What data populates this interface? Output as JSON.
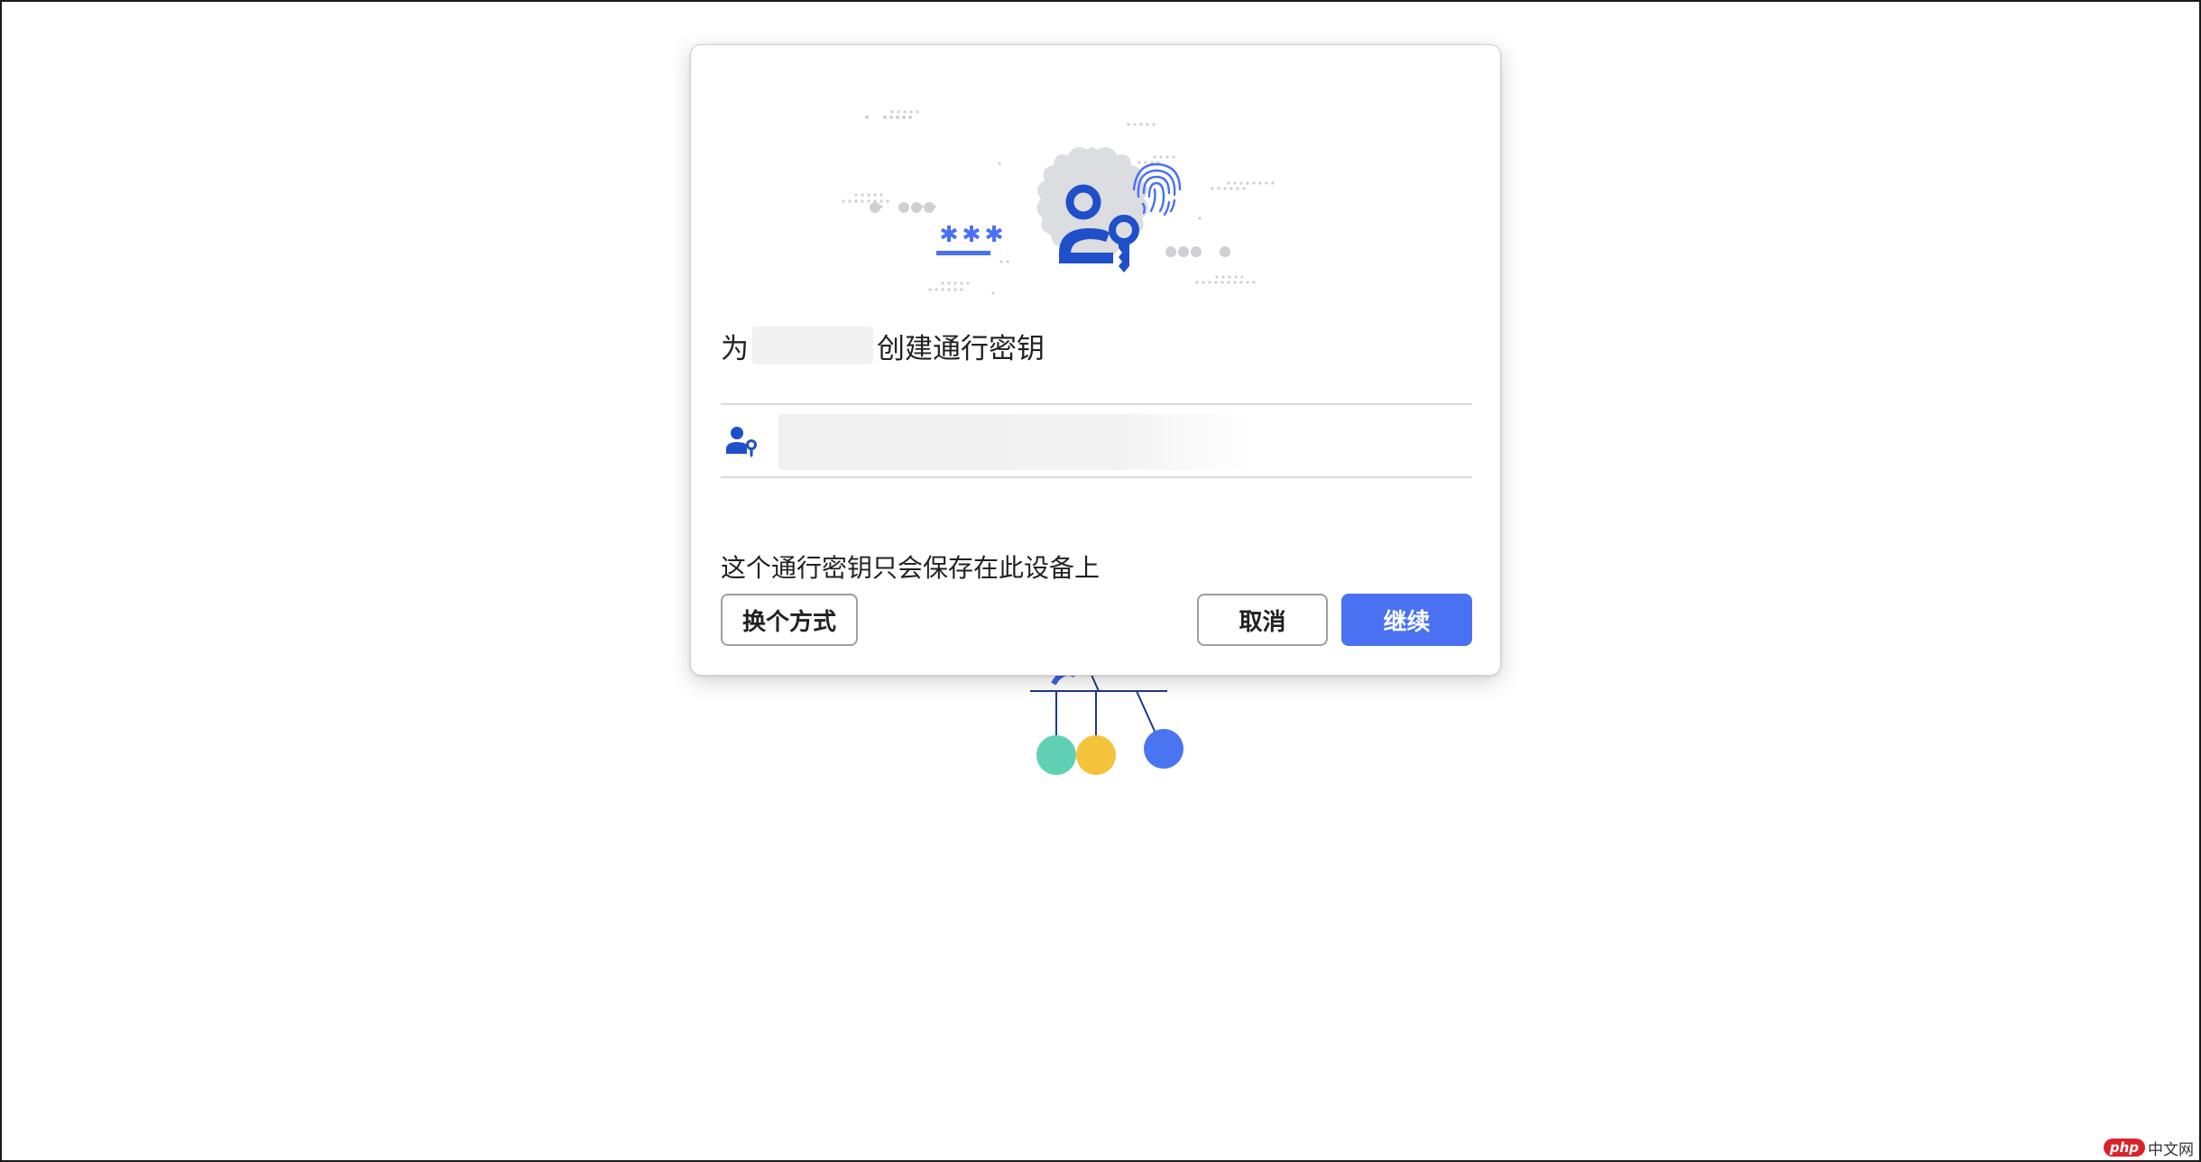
{
  "dialog": {
    "title_prefix": "为",
    "title_suffix": "创建通行密钥",
    "description": "这个通行密钥只会保存在此设备上",
    "buttons": {
      "alternative": "换个方式",
      "cancel": "取消",
      "continue": "继续"
    }
  },
  "watermark": {
    "logo": "php",
    "text": "中文网"
  },
  "colors": {
    "accent": "#4a71f2",
    "icon_blue": "#1f4fc9",
    "badge_gray": "#dcdde1",
    "ball_green": "#5fd0b4",
    "ball_yellow": "#f5c33b",
    "ball_blue": "#4b74f0"
  },
  "icons": {
    "hero": "passkey-person-key-icon",
    "fingerprint": "fingerprint-icon",
    "account": "passkey-account-icon"
  }
}
